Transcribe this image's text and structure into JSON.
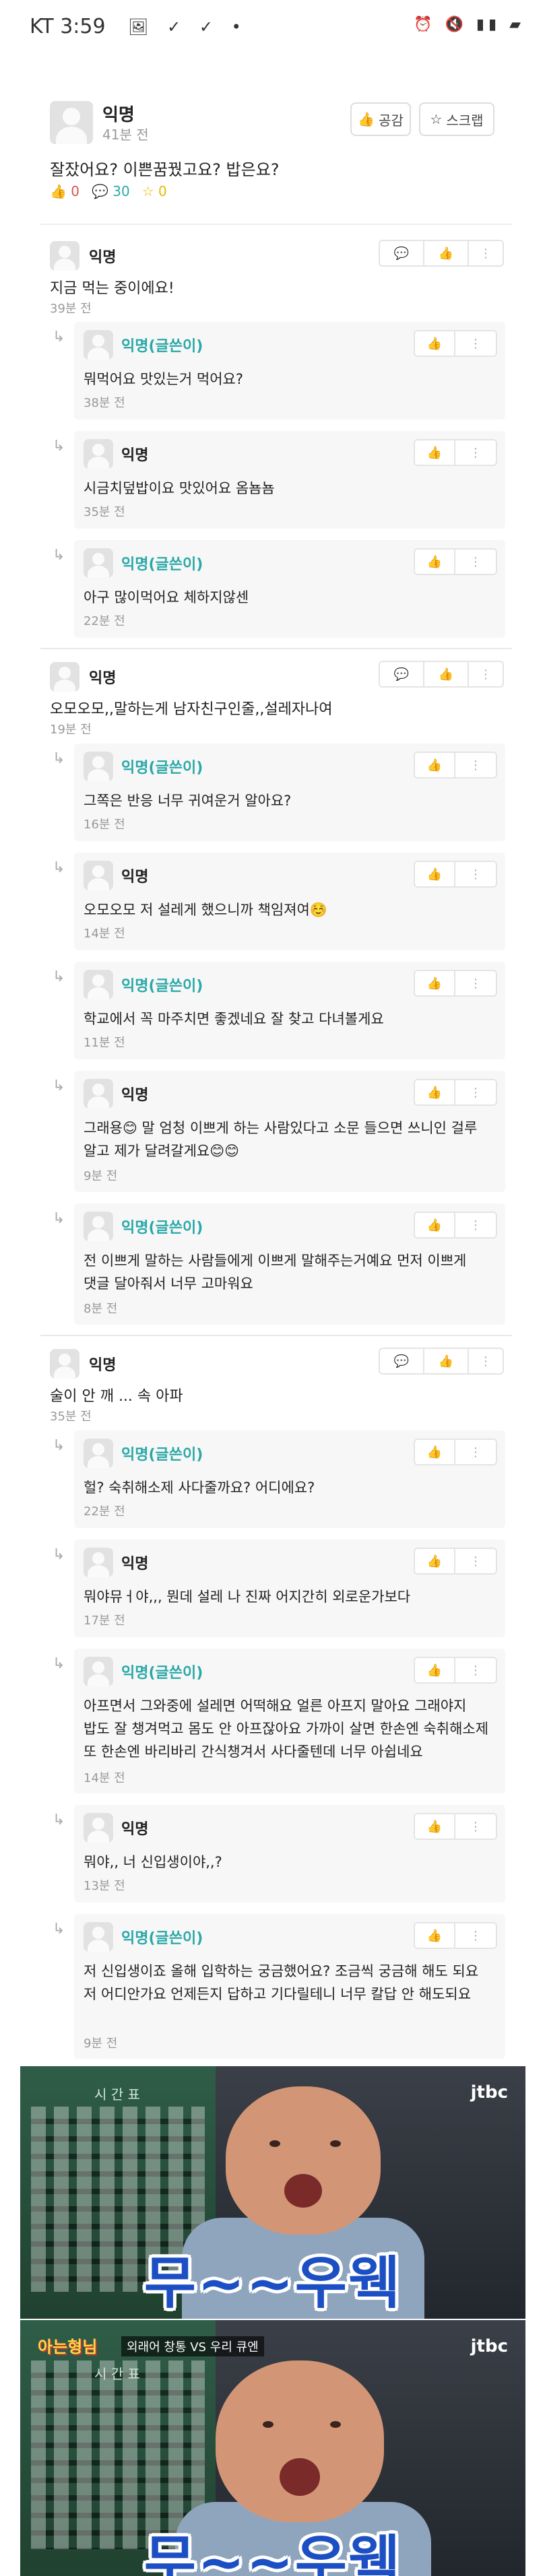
{
  "status_bar": {
    "carrier_time": "KT 3:59"
  },
  "post": {
    "author": "익명",
    "time": "41분 전",
    "like_button": "공감",
    "scrap_button": "스크랩",
    "content": "잘잤어요? 이쁜꿈꿨고요? 밥은요?",
    "like_count": "0",
    "comment_count": "30",
    "scrap_count": "0"
  },
  "threads": [
    {
      "author": "익명",
      "content": "지금 먹는 중이에요!",
      "time": "39분 전",
      "replies": [
        {
          "author": "익명(글쓴이)",
          "content": "뭐먹어요 맛있는거 먹어요?",
          "time": "38분 전"
        },
        {
          "author": "익명",
          "content": "시금치덮밥이요 맛있어요 옴뇸뇸",
          "time": "35분 전"
        },
        {
          "author": "익명(글쓴이)",
          "content": "아구 많이먹어요 체하지않센",
          "time": "22분 전"
        }
      ]
    },
    {
      "author": "익명",
      "content": "오모오모,,말하는게 남자친구인줄,,설레자나여",
      "time": "19분 전",
      "replies": [
        {
          "author": "익명(글쓴이)",
          "content": "그쪽은 반응 너무 귀여운거 알아요?",
          "time": "16분 전"
        },
        {
          "author": "익명",
          "content": "오모오모 저 설레게 했으니까 책임져여☺️",
          "time": "14분 전"
        },
        {
          "author": "익명(글쓴이)",
          "content": "학교에서 꼭 마주치면 좋겠네요 잘 찾고 다녀볼게요",
          "time": "11분 전"
        },
        {
          "author": "익명",
          "content": "그래용😊 말 엄청 이쁘게 하는 사람있다고 소문 들으면 쓰니인 걸루 알고 제가 달려갈게요😊😊",
          "time": "9분 전"
        },
        {
          "author": "익명(글쓴이)",
          "content": "전 이쁘게 말하는 사람들에게 이쁘게 말해주는거예요 먼저 이쁘게 댓글 달아줘서 너무 고마워요",
          "time": "8분 전"
        }
      ]
    },
    {
      "author": "익명",
      "content": "술이 안 깨 ... 속 아파",
      "time": "35분 전",
      "replies": [
        {
          "author": "익명(글쓴이)",
          "content": "헐? 숙취해소제 사다줄까요? 어디에요?",
          "time": "22분 전"
        },
        {
          "author": "익명",
          "content": "뭐야뮤ㅓ야,,, 뭔데 설레 나 진짜 어지간히 외로운가보다",
          "time": "17분 전"
        },
        {
          "author": "익명(글쓴이)",
          "content": "아프면서 그와중에 설레면 어떡해요 얼른 아프지 말아요 그래야지 밥도 잘 챙겨먹고 몸도 안 아프잖아요 가까이 살면 한손엔 숙취해소제 또 한손엔 바리바리 간식챙겨서 사다줄텐데 너무 아쉽네요",
          "time": "14분 전"
        },
        {
          "author": "익명",
          "content": "뭐야,, 너 신입생이야,,?",
          "time": "13분 전"
        },
        {
          "author": "익명(글쓴이)",
          "content": "저 신입생이죠 올해 입학하는 궁금했어요? 조금씩 궁금해 해도 되요 저 어디안가요 언제든지 답하고 기다릴테니 너무 칼답 안 해도되요",
          "time": "9분 전"
        }
      ]
    }
  ],
  "memes": [
    {
      "caption": "무~~우웩",
      "jtbc": "jtbc",
      "board_title": "시 간 표"
    },
    {
      "caption": "무~~우웩",
      "jtbc": "jtbc",
      "show_logo": "아는형님",
      "subtitle": "외래어 창통 VS 우리 큐엔",
      "board_title": "시 간 표"
    }
  ]
}
